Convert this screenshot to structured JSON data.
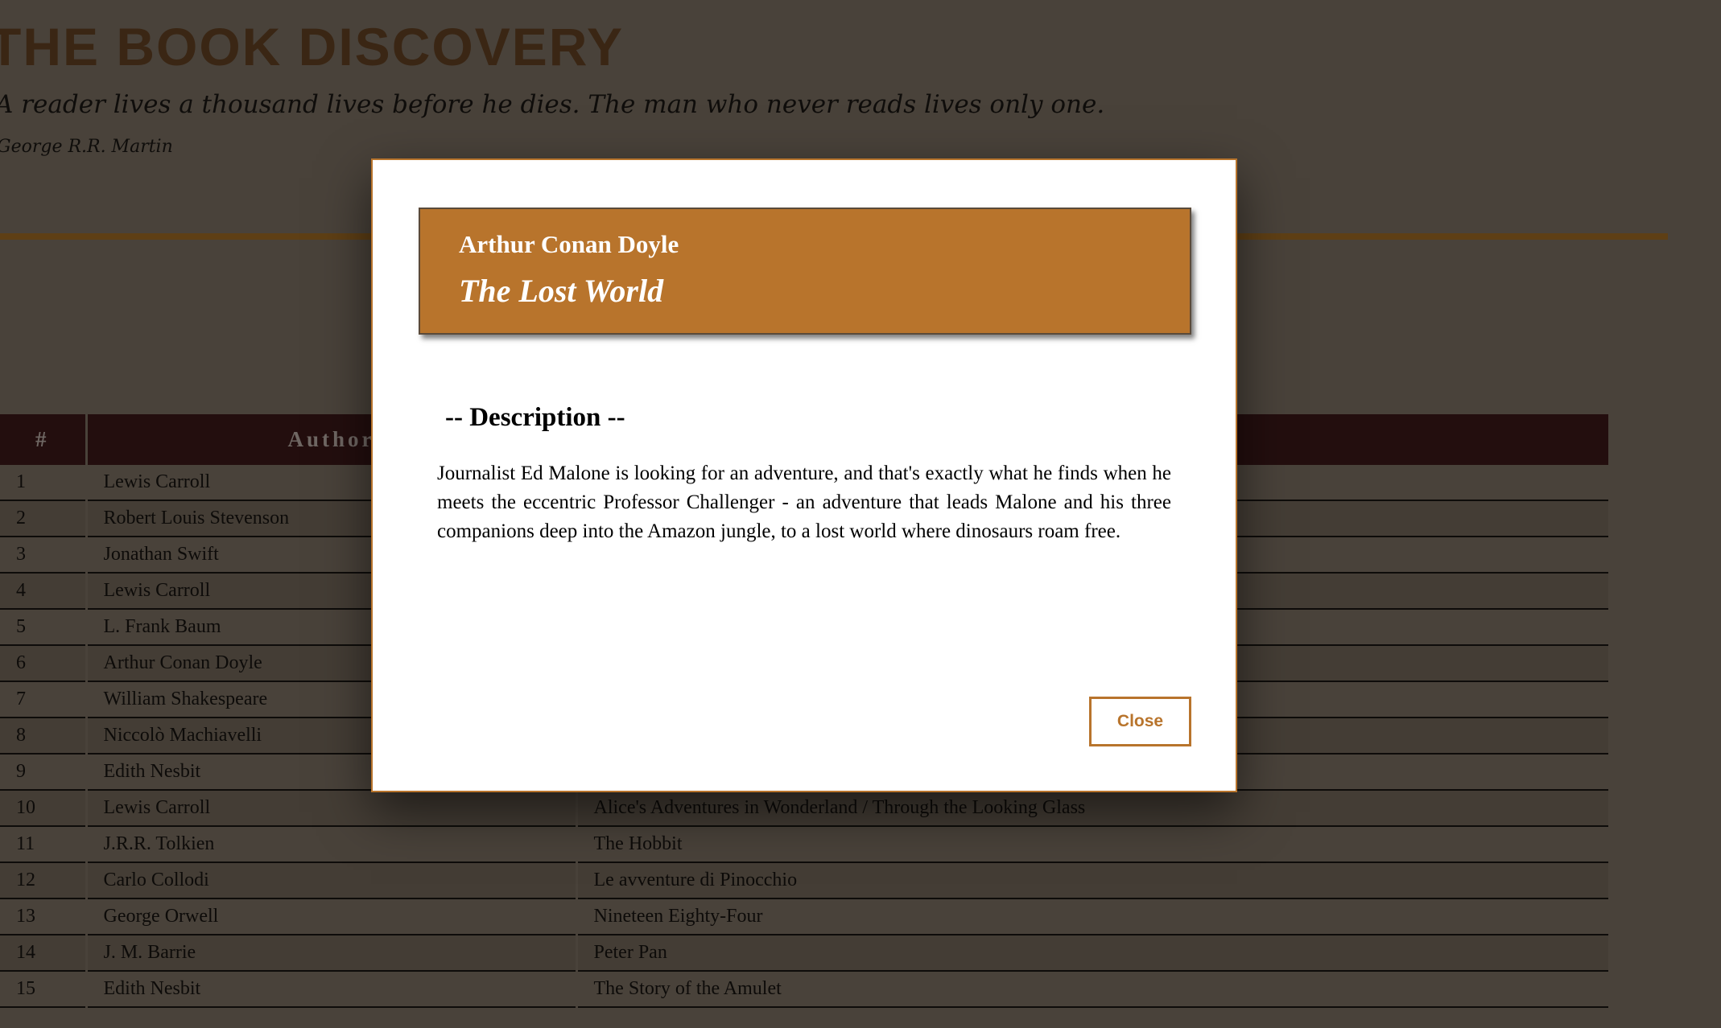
{
  "header": {
    "title": "THE BOOK DISCOVERY",
    "quote": "A reader lives a thousand lives before he dies. The man who never reads lives only one.",
    "quote_author": "George R.R. Martin"
  },
  "table": {
    "columns": [
      "#",
      "Author",
      ""
    ],
    "rows": [
      {
        "num": "1",
        "author": "Lewis Carroll",
        "title": ""
      },
      {
        "num": "2",
        "author": "Robert Louis Stevenson",
        "title": ""
      },
      {
        "num": "3",
        "author": "Jonathan Swift",
        "title": ""
      },
      {
        "num": "4",
        "author": "Lewis Carroll",
        "title": ""
      },
      {
        "num": "5",
        "author": "L. Frank Baum",
        "title": ""
      },
      {
        "num": "6",
        "author": "Arthur Conan Doyle",
        "title": ""
      },
      {
        "num": "7",
        "author": "William Shakespeare",
        "title": ""
      },
      {
        "num": "8",
        "author": "Niccolò Machiavelli",
        "title": ""
      },
      {
        "num": "9",
        "author": "Edith Nesbit",
        "title": ""
      },
      {
        "num": "10",
        "author": "Lewis Carroll",
        "title": "Alice's Adventures in Wonderland / Through the Looking Glass"
      },
      {
        "num": "11",
        "author": "J.R.R. Tolkien",
        "title": "The Hobbit"
      },
      {
        "num": "12",
        "author": "Carlo Collodi",
        "title": "Le avventure di Pinocchio"
      },
      {
        "num": "13",
        "author": "George Orwell",
        "title": "Nineteen Eighty-Four"
      },
      {
        "num": "14",
        "author": "J. M. Barrie",
        "title": "Peter Pan"
      },
      {
        "num": "15",
        "author": "Edith Nesbit",
        "title": "The Story of the Amulet"
      }
    ]
  },
  "modal": {
    "author": "Arthur Conan Doyle",
    "book_title": "The Lost World",
    "description_heading": "-- Description --",
    "description": "Journalist Ed Malone is looking for an adventure, and that's exactly what he finds when he meets the eccentric Professor Challenger - an adventure that leads Malone and his three companions deep into the Amazon jungle, to a lost world where dinosaurs roam free.",
    "close_label": "Close"
  },
  "colors": {
    "background": "#49423a",
    "accent": "#b8742c",
    "table_header": "#230e0e",
    "title": "#3a2614"
  }
}
